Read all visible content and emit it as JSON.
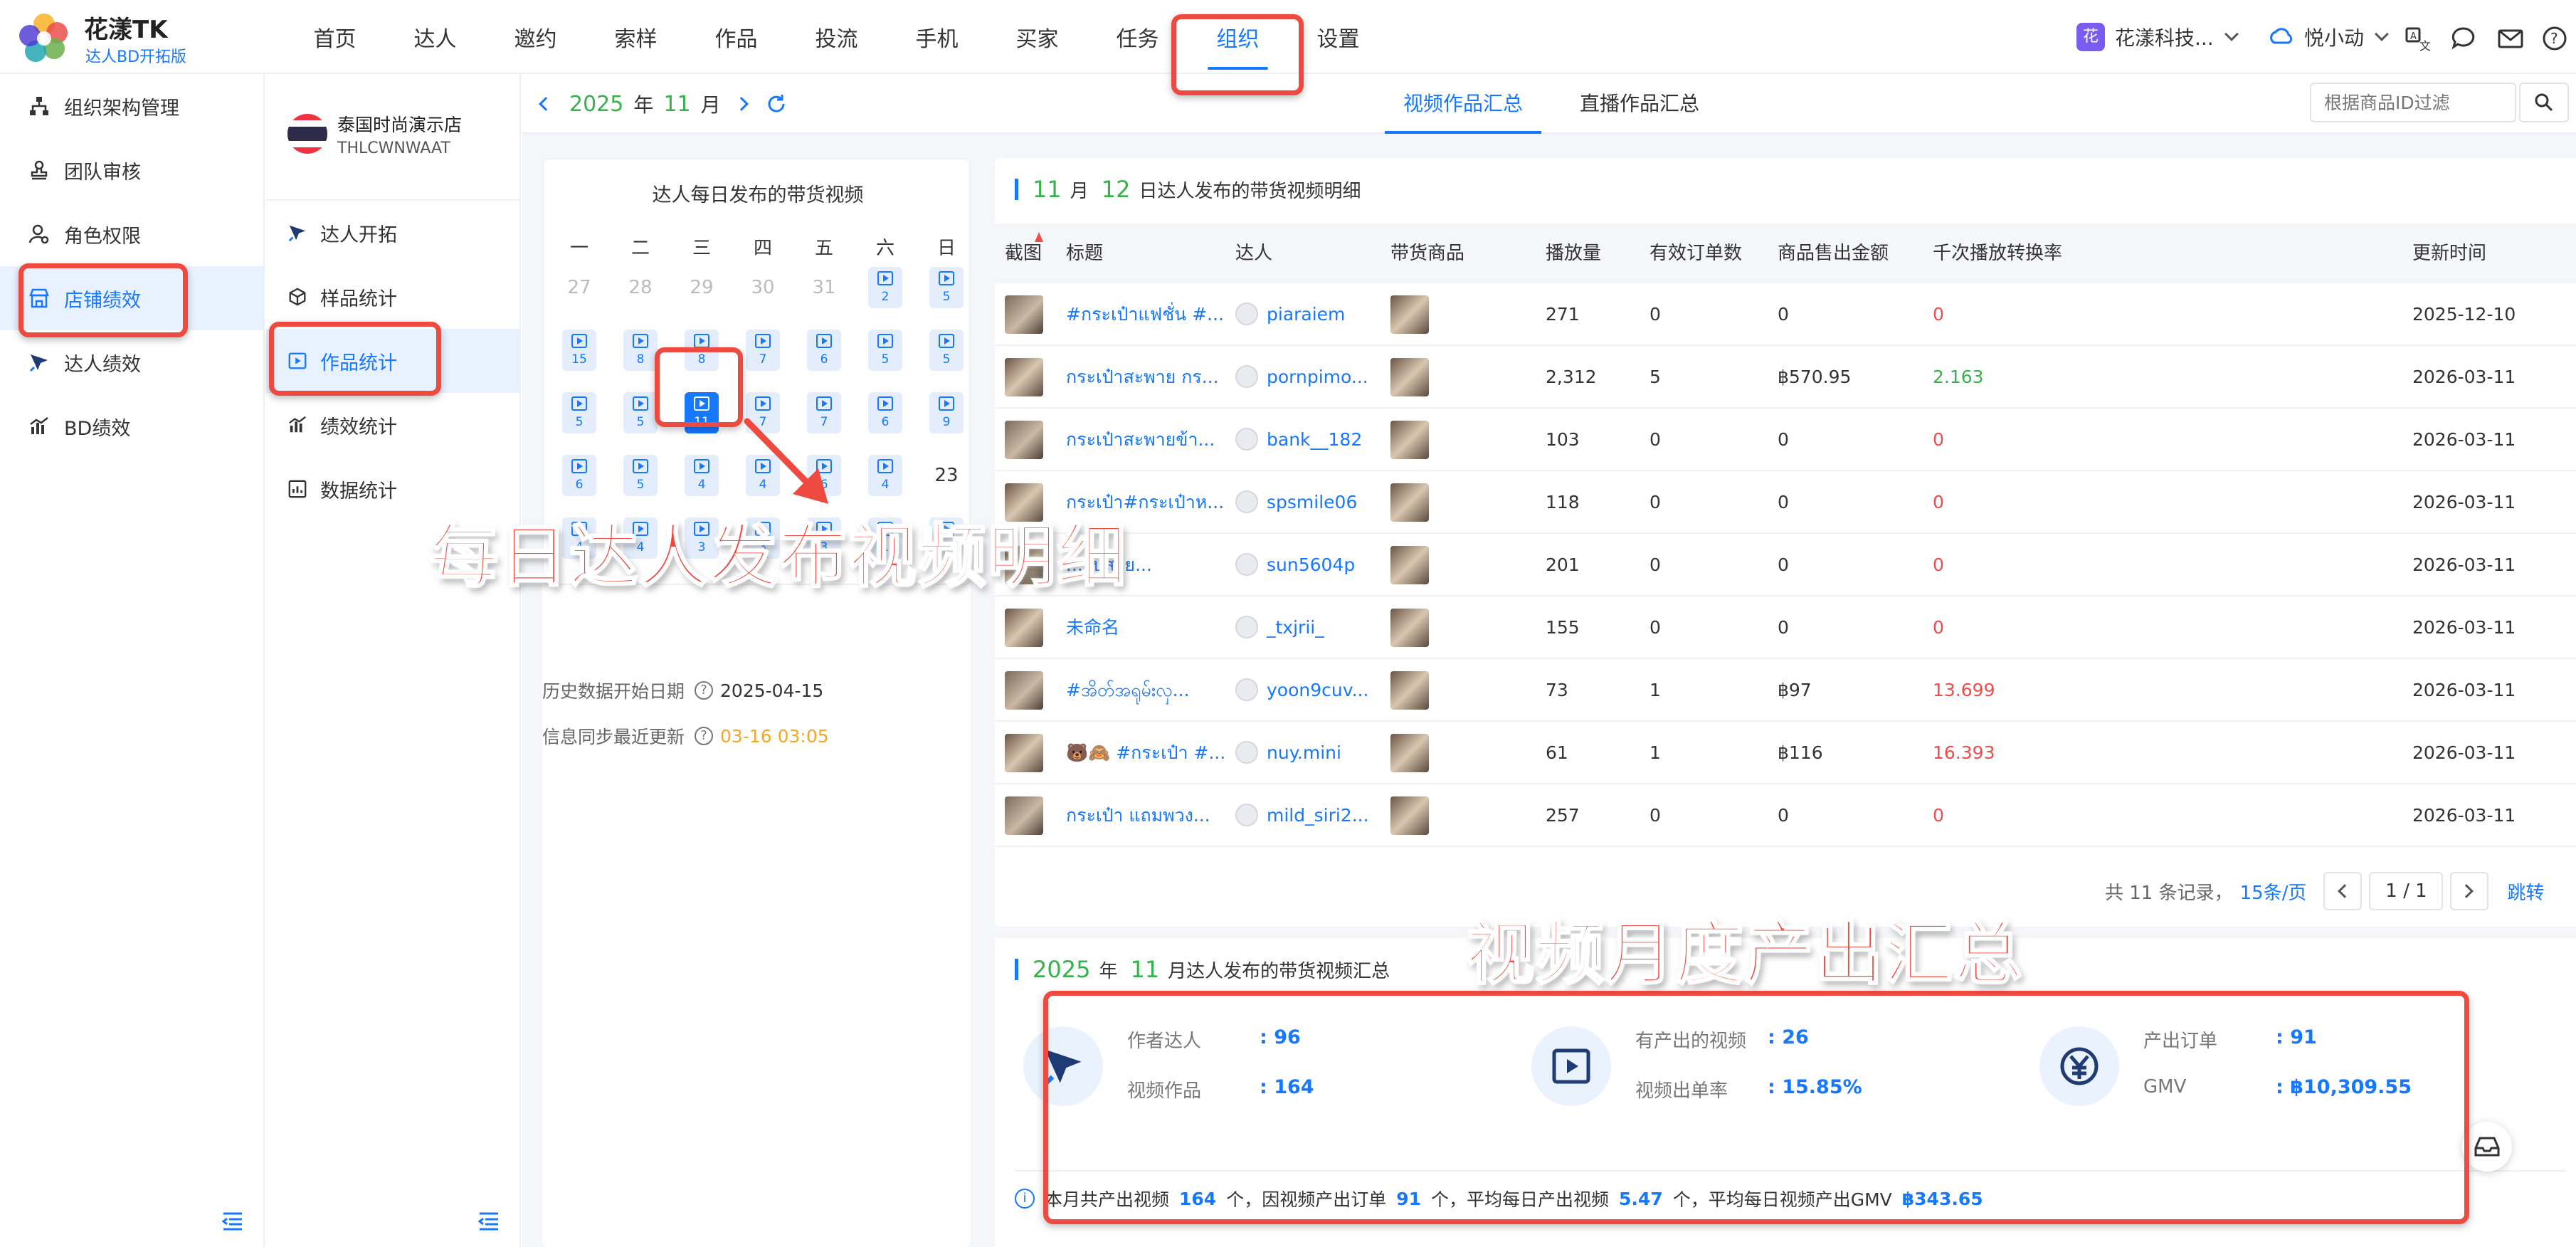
{
  "header": {
    "brand_name": "花漾TK",
    "brand_sub": "达人BD开拓版",
    "nav": [
      "首页",
      "达人",
      "邀约",
      "索样",
      "作品",
      "投流",
      "手机",
      "买家",
      "任务",
      "组织",
      "设置"
    ],
    "active_nav": "组织",
    "org_badge": "花",
    "org_name": "花漾科技...",
    "user_name": "悦小动"
  },
  "sidebar": {
    "items": [
      "组织架构管理",
      "团队审核",
      "角色权限",
      "店铺绩效",
      "达人绩效",
      "BD绩效"
    ],
    "active": "店铺绩效"
  },
  "subnav": {
    "shop_name": "泰国时尚演示店",
    "shop_code": "THLCWNWAAT",
    "items": [
      "达人开拓",
      "样品统计",
      "作品统计",
      "绩效统计",
      "数据统计"
    ],
    "active": "作品统计"
  },
  "toolbar": {
    "year": "2025",
    "year_unit": "年",
    "month": "11",
    "month_unit": "月",
    "tabs": [
      "视频作品汇总",
      "直播作品汇总"
    ],
    "active_tab": "视频作品汇总",
    "filter_placeholder": "根据商品ID过滤"
  },
  "calendar": {
    "title": "达人每日发布的带货视频",
    "weekdays": [
      "一",
      "二",
      "三",
      "四",
      "五",
      "六",
      "日"
    ],
    "weeks": [
      [
        {
          "d": "27",
          "t": "off"
        },
        {
          "d": "28",
          "t": "off"
        },
        {
          "d": "29",
          "t": "off"
        },
        {
          "d": "30",
          "t": "off"
        },
        {
          "d": "31",
          "t": "off"
        },
        {
          "d": "2",
          "t": "vid"
        },
        {
          "d": "5",
          "t": "vid"
        }
      ],
      [
        {
          "d": "15",
          "t": "vid"
        },
        {
          "d": "8",
          "t": "vid"
        },
        {
          "d": "8",
          "t": "vid"
        },
        {
          "d": "7",
          "t": "vid"
        },
        {
          "d": "6",
          "t": "vid"
        },
        {
          "d": "5",
          "t": "vid"
        },
        {
          "d": "5",
          "t": "vid"
        }
      ],
      [
        {
          "d": "5",
          "t": "vid"
        },
        {
          "d": "5",
          "t": "vid"
        },
        {
          "d": "11",
          "t": "sel"
        },
        {
          "d": "7",
          "t": "vid"
        },
        {
          "d": "7",
          "t": "vid"
        },
        {
          "d": "6",
          "t": "vid"
        },
        {
          "d": "9",
          "t": "vid"
        }
      ],
      [
        {
          "d": "6",
          "t": "vid"
        },
        {
          "d": "5",
          "t": "vid"
        },
        {
          "d": "4",
          "t": "vid"
        },
        {
          "d": "4",
          "t": "vid"
        },
        {
          "d": "6",
          "t": "vid"
        },
        {
          "d": "4",
          "t": "vid"
        },
        {
          "d": "23",
          "t": "plain"
        }
      ],
      [
        {
          "d": "4",
          "t": "vid"
        },
        {
          "d": "4",
          "t": "vid"
        },
        {
          "d": "3",
          "t": "vid"
        },
        {
          "d": "3",
          "t": "vid"
        },
        {
          "d": "3",
          "t": "vid"
        },
        {
          "d": "1",
          "t": "vid"
        },
        {
          "d": "4",
          "t": "vid"
        }
      ]
    ],
    "history_label": "历史数据开始日期",
    "history_value": "2025-04-15",
    "sync_label": "信息同步最近更新",
    "sync_value": "03-16 03:05"
  },
  "detail": {
    "month": "11",
    "month_unit": "月",
    "day": "12",
    "title_suffix": "日达人发布的带货视频明细",
    "columns": [
      "截图",
      "标题",
      "达人",
      "带货商品",
      "播放量",
      "有效订单数",
      "商品售出金额",
      "千次播放转换率",
      "更新时间"
    ],
    "rows": [
      {
        "title": "#กระเป๋าแฟชั่น #...",
        "creator": "piaraiem",
        "views": "271",
        "orders": "0",
        "amount": "0",
        "rate": "0",
        "rate_color": "red",
        "updated": "2025-12-10"
      },
      {
        "title": "กระเป๋าสะพาย กร...",
        "creator": "pornpimo...",
        "views": "2,312",
        "orders": "5",
        "amount": "฿570.95",
        "rate": "2.163",
        "rate_color": "green",
        "updated": "2026-03-11"
      },
      {
        "title": "กระเป๋าสะพายข้า...",
        "creator": "bank__182",
        "views": "103",
        "orders": "0",
        "amount": "0",
        "rate": "0",
        "rate_color": "red",
        "updated": "2026-03-11"
      },
      {
        "title": "กระเป๋า#กระเป๋าห...",
        "creator": "spsmile06",
        "views": "118",
        "orders": "0",
        "amount": "0",
        "rate": "0",
        "rate_color": "red",
        "updated": "2026-03-11"
      },
      {
        "title": "...รับสาย...",
        "creator": "sun5604p",
        "views": "201",
        "orders": "0",
        "amount": "0",
        "rate": "0",
        "rate_color": "red",
        "updated": "2026-03-11"
      },
      {
        "title": "未命名",
        "creator": "_txjrii_",
        "views": "155",
        "orders": "0",
        "amount": "0",
        "rate": "0",
        "rate_color": "red",
        "updated": "2026-03-11"
      },
      {
        "title": "#အိတ်အရုမ်းလှ...",
        "creator": "yoon9cuv...",
        "views": "73",
        "orders": "1",
        "amount": "฿97",
        "rate": "13.699",
        "rate_color": "red",
        "updated": "2026-03-11"
      },
      {
        "title": "🐻🙈 #กระเป๋า #...",
        "creator": "nuy.mini",
        "views": "61",
        "orders": "1",
        "amount": "฿116",
        "rate": "16.393",
        "rate_color": "red",
        "updated": "2026-03-11"
      },
      {
        "title": "กระเป๋า แถมพวง...",
        "creator": "mild_siri2...",
        "views": "257",
        "orders": "0",
        "amount": "0",
        "rate": "0",
        "rate_color": "red",
        "updated": "2026-03-11"
      }
    ],
    "pager": {
      "total_text": "共 11 条记录，",
      "page_size": "15条/页",
      "page": "1 / 1",
      "jump": "跳转"
    }
  },
  "summary": {
    "year": "2025",
    "year_unit": "年",
    "month": "11",
    "title_suffix": "月达人发布的带货视频汇总",
    "stats": [
      {
        "label1": "作者达人",
        "val1": "96",
        "label2": "视频作品",
        "val2": "164",
        "icon": "tiktok-creator-icon"
      },
      {
        "label1": "有产出的视频",
        "val1": "26",
        "label2": "视频出单率",
        "val2": "15.85%",
        "icon": "video-play-icon"
      },
      {
        "label1": "产出订单",
        "val1": "91",
        "label2": "GMV",
        "val2": "฿10,309.55",
        "icon": "yen-icon"
      }
    ],
    "note": {
      "p1": "本月共产出视频",
      "v1": "164",
      "p2": "个，因视频产出订单",
      "v2": "91",
      "p3": "个，平均每日产出视频",
      "v3": "5.47",
      "p4": "个，平均每日视频产出GMV",
      "v4": "฿343.65"
    }
  },
  "annotations": {
    "callout_daily": "每日达人发布视频明细",
    "callout_monthly": "视频月度产出汇总"
  }
}
